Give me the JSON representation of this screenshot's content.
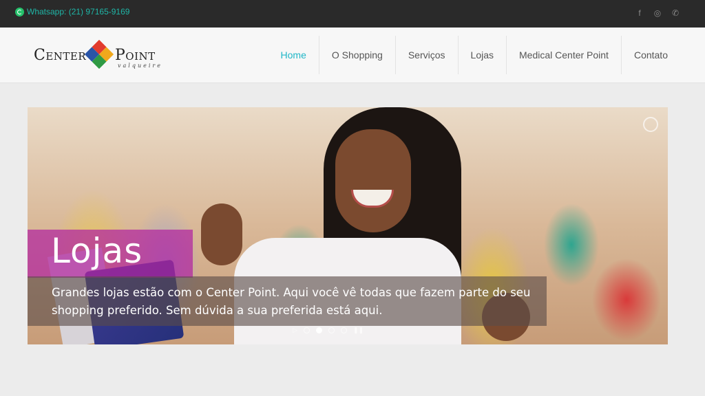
{
  "topbar": {
    "whatsapp_label": "Whatsapp: (21) 97165-9169",
    "social": [
      {
        "icon": "facebook-icon",
        "glyph": "f"
      },
      {
        "icon": "instagram-icon",
        "glyph": "◎"
      },
      {
        "icon": "phone-icon",
        "glyph": "✆"
      }
    ]
  },
  "logo": {
    "left": "Center",
    "right": "Point",
    "subtitle": "valqueire"
  },
  "nav": {
    "items": [
      {
        "label": "Home"
      },
      {
        "label": "O Shopping"
      },
      {
        "label": "Serviços"
      },
      {
        "label": "Lojas"
      },
      {
        "label": "Medical Center Point"
      },
      {
        "label": "Contato"
      }
    ]
  },
  "slider": {
    "title": "Lojas",
    "text": "Grandes lojas estão com o Center Point. Aqui você vê todas que fazem parte do seu shopping preferido. Sem dúvida a sua preferida está aqui.",
    "dot_count": 5,
    "active_index": 1
  },
  "colors": {
    "accent": "#1fb6c7",
    "whatsapp": "#1fb6a7",
    "title_box": "#b224a0"
  }
}
